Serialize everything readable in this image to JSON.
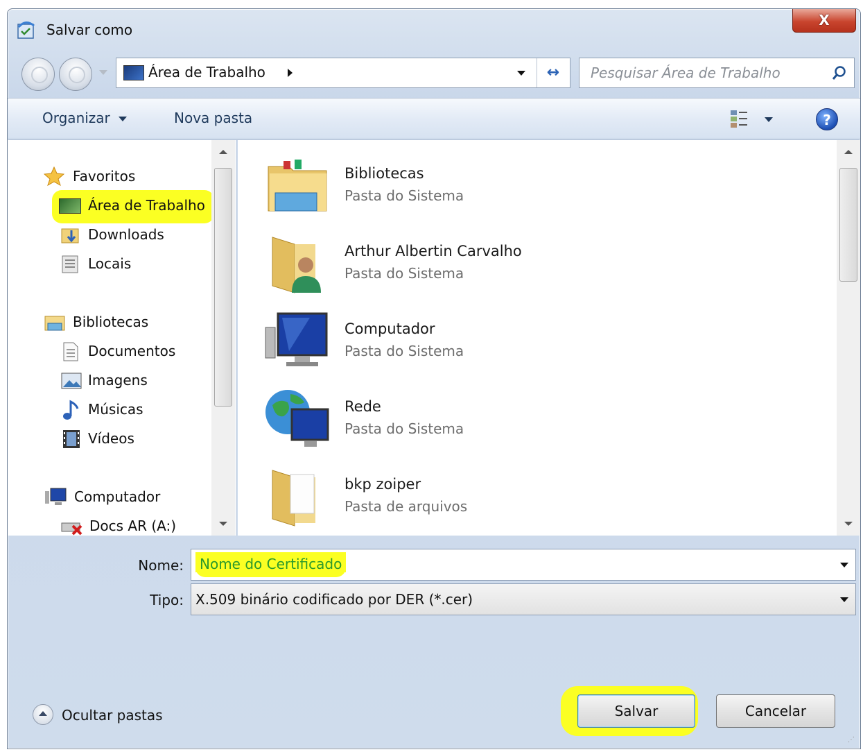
{
  "window": {
    "title": "Salvar como",
    "close_label": "X"
  },
  "address": {
    "location": "Área de Trabalho",
    "refresh_glyph": "↔"
  },
  "search": {
    "placeholder": "Pesquisar Área de Trabalho"
  },
  "toolbar": {
    "organize": "Organizar",
    "new_folder": "Nova pasta",
    "help_glyph": "?"
  },
  "sidebar": {
    "favorites": "Favoritos",
    "desktop": "Área de Trabalho",
    "downloads": "Downloads",
    "recent": "Locais",
    "libraries": "Bibliotecas",
    "documents": "Documentos",
    "pictures": "Imagens",
    "music": "Músicas",
    "videos": "Vídeos",
    "computer": "Computador",
    "drive": "Docs AR (A:)"
  },
  "files": [
    {
      "name": "Bibliotecas",
      "type": "Pasta do Sistema"
    },
    {
      "name": "Arthur Albertin Carvalho",
      "type": "Pasta do Sistema"
    },
    {
      "name": "Computador",
      "type": "Pasta do Sistema"
    },
    {
      "name": "Rede",
      "type": "Pasta do Sistema"
    },
    {
      "name": "bkp zoiper",
      "type": "Pasta de arquivos"
    }
  ],
  "form": {
    "name_label": "Nome:",
    "name_value": "Nome do Certificado",
    "type_label": "Tipo:",
    "type_value": "X.509 binário codificado por DER (*.cer)"
  },
  "footer": {
    "hide_folders": "Ocultar pastas",
    "save": "Salvar",
    "cancel": "Cancelar"
  },
  "colors": {
    "highlight": "#fbff23",
    "toolbar_text": "#1e395b"
  }
}
